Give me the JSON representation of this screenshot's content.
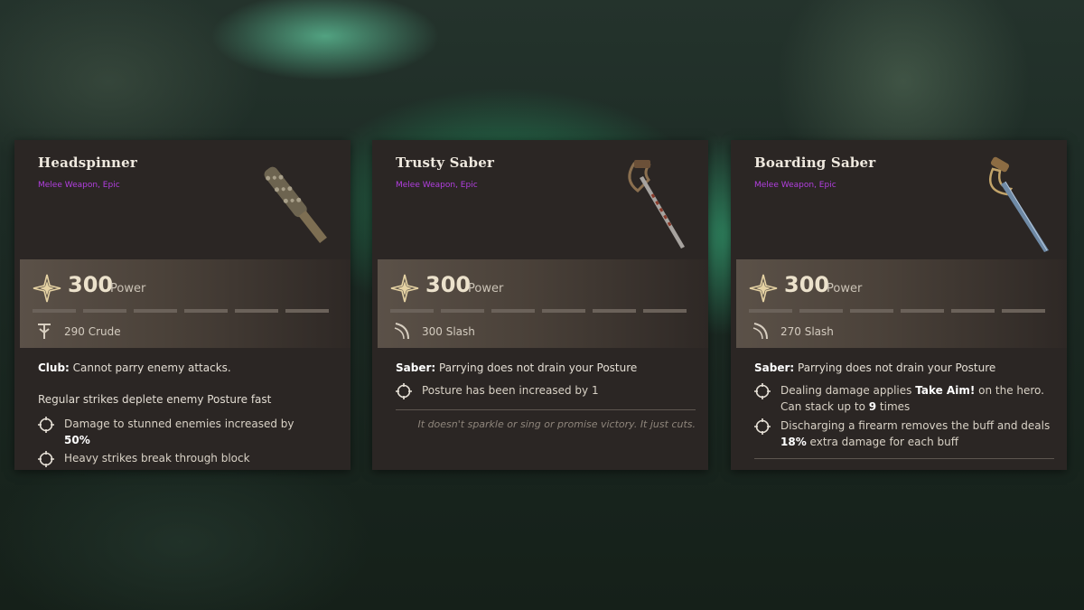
{
  "cards": [
    {
      "name": "Headspinner",
      "subtitle": "Melee Weapon, Epic",
      "power_value": "300",
      "power_label": "Power",
      "damage": "290 Crude",
      "desc_type": "Club:",
      "desc_text": " Cannot parry enemy attacks.",
      "extra_line": "Regular strikes deplete enemy Posture fast",
      "bullet1_a": "Damage to stunned enemies increased by",
      "bullet1_b": "50%",
      "bullet2": "Heavy strikes break through block"
    },
    {
      "name": "Trusty Saber",
      "subtitle": "Melee Weapon, Epic",
      "power_value": "300",
      "power_label": "Power",
      "damage": "300 Slash",
      "desc_type": "Saber:",
      "desc_text": " Parrying does not drain your Posture",
      "bullet1": "Posture has been increased by 1",
      "quote": "It doesn't sparkle or sing or promise victory. It just cuts."
    },
    {
      "name": "Boarding Saber",
      "subtitle": "Melee Weapon, Epic",
      "power_value": "300",
      "power_label": "Power",
      "damage": "270 Slash",
      "desc_type": "Saber:",
      "desc_text": " Parrying does not drain your Posture",
      "bullet1_a": "Dealing damage applies ",
      "bullet1_b": "Take Aim!",
      "bullet1_c": " on the hero. Can stack up to ",
      "bullet1_d": "9",
      "bullet1_e": " times",
      "bullet2_a": "Discharging a firearm removes the buff and deals ",
      "bullet2_b": "18%",
      "bullet2_c": " extra damage for each buff"
    }
  ],
  "colors": {
    "rarity": "#b23fe0",
    "card_bg": "#2b2624",
    "power_band": "#5b5148"
  },
  "icons": [
    "power-star-icon",
    "crude-damage-icon",
    "slash-damage-icon",
    "perk-ring-icon"
  ]
}
